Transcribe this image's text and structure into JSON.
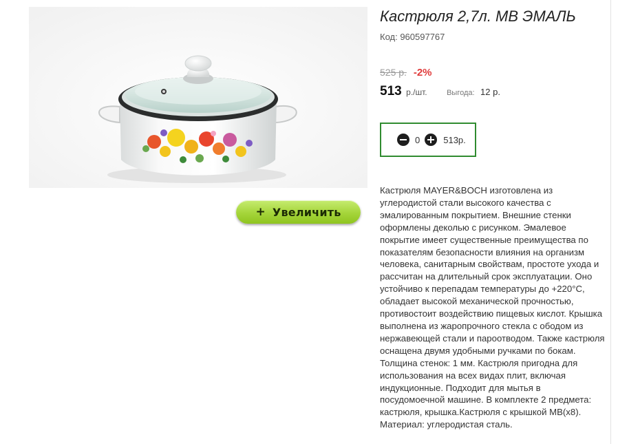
{
  "product": {
    "title": "Кастрюля 2,7л. МВ ЭМАЛЬ",
    "code": "Код: 960597767",
    "image_alt_icon": "enamel-pot-image"
  },
  "price": {
    "old": "525 р.",
    "discount": "-2%",
    "current": "513",
    "unit": "р./шт.",
    "benefit_label": "Выгода:",
    "benefit_value": "12 р."
  },
  "cart": {
    "quantity": "0",
    "total": "513р.",
    "minus_icon": "minus-circle-icon",
    "plus_icon": "plus-circle-icon"
  },
  "zoom_button": {
    "plus": "+",
    "label": "Увеличить"
  },
  "description": "Кастрюля MAYER&BOCH изготовлена из углеродистой стали высокого качества с эмалированным покрытием. Внешние стенки оформлены деколью с рисунком. Эмалевое покрытие имеет существенные преимущества по показателям безопасности влияния на организм человека, санитарным свойствам, простоте ухода и рассчитан на длительный срок эксплуатации. Оно устойчиво к перепадам температуры до +220°С, обладает высокой механической прочностью, противостоит воздействию пищевых кислот. Крышка выполнена из жаропрочного стекла с ободом из нержавеющей стали и пароотводом. Также кастрюля оснащена двумя удобными ручками по бокам. Толщина стенок: 1 мм. Кастрюля пригодна для использования на всех видах плит, включая индукционные. Подходит для мытья в посудомоечной машине. В комплекте 2 предмета: кастрюля, крышка.Кастрюля с крышкой МВ(х8). Материал: углеродистая сталь."
}
